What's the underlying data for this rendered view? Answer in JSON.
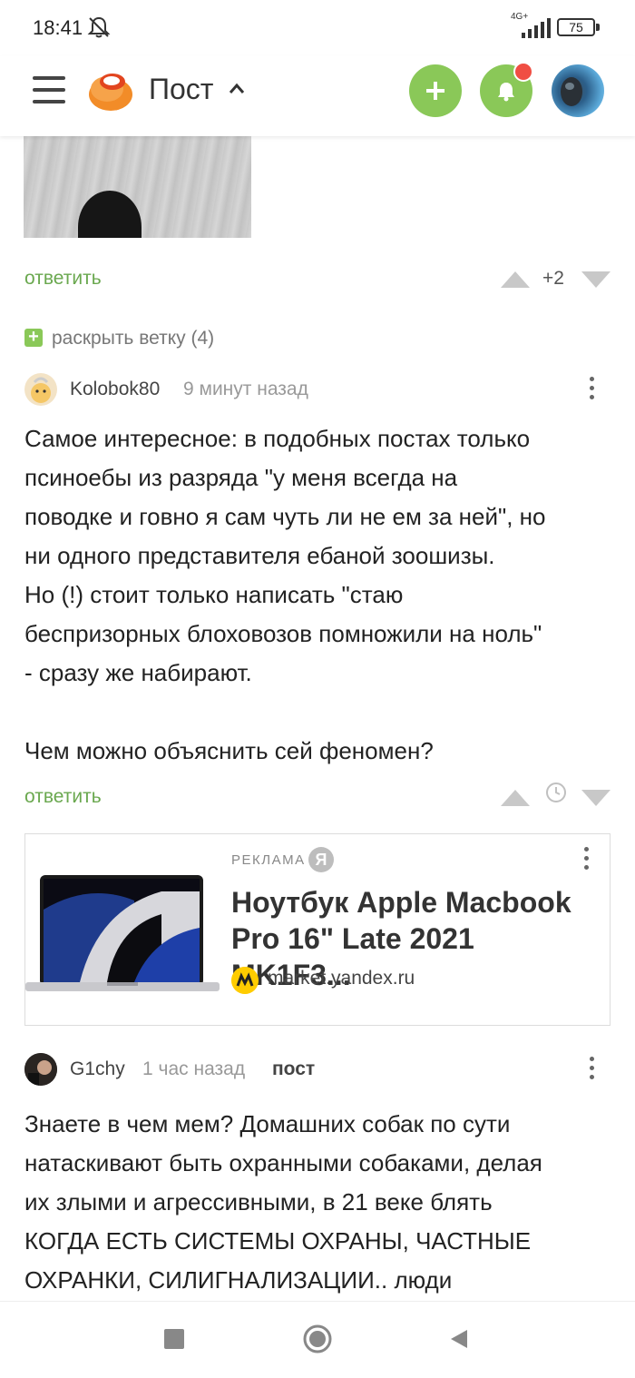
{
  "status_bar": {
    "time": "18:41",
    "network": "4G+",
    "battery": "75"
  },
  "header": {
    "title": "Пост",
    "icons": [
      "menu-icon",
      "pikabu-logo",
      "chevron-up-icon",
      "plus-icon",
      "bell-icon",
      "user-avatar"
    ],
    "accent_color": "#8ac858",
    "badge_color": "#f04e43"
  },
  "thread1": {
    "reply": "ответить",
    "rating": "+2",
    "expand": "раскрыть ветку (4)"
  },
  "comment1": {
    "author": "Kolobok80",
    "time": "9 минут назад",
    "text": "Самое интересное: в подобных постах только\nпсиноебы из разряда \"у меня всегда на\nповодке и говно я сам чуть ли не ем за ней\", но\nни одного представителя ебаной зоошизы.\nНо (!) стоит только написать \"стаю\nбеспризорных блоховозов помножили на ноль\"\n- сразу же набирают.\n\nЧем можно объяснить сей феномен?",
    "reply": "ответить"
  },
  "ad": {
    "label": "РЕКЛАМА",
    "badge": "Я",
    "title": "Ноутбук Apple Macbook Pro 16\" Late 2021 MK1F3...",
    "domain": "market.yandex.ru"
  },
  "comment2": {
    "author": "G1chy",
    "time": "1 час назад",
    "tag": "пост",
    "text": "Знаете в чем мем? Домашних собак по сути\nнатаскивают быть охранными собаками, делая\nих злыми и агрессивными, в 21 веке блять\nКОГДА ЕСТЬ СИСТЕМЫ ОХРАНЫ, ЧАСТНЫЕ\nОХРАНКИ, СИЛИГНАЛИЗАЦИИ.. люди"
  }
}
